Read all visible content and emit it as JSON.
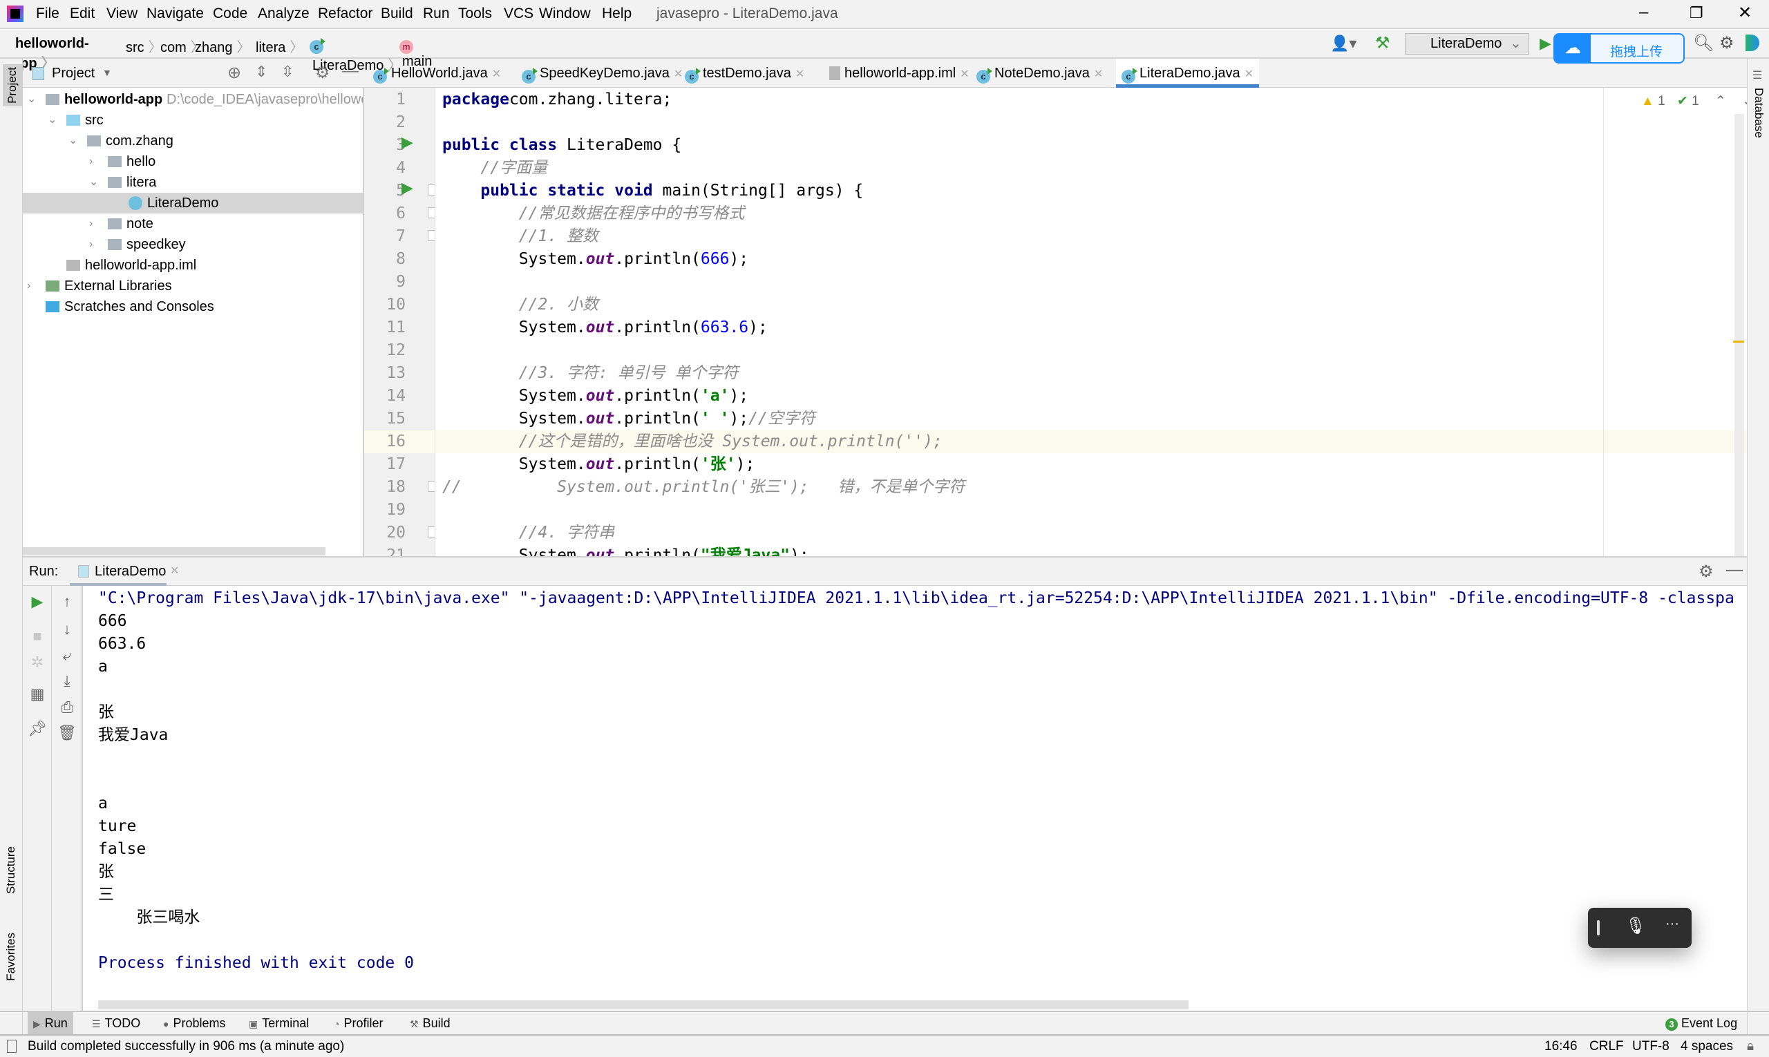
{
  "window": {
    "title": "javasepro - LiteraDemo.java"
  },
  "menu": [
    "File",
    "Edit",
    "View",
    "Navigate",
    "Code",
    "Analyze",
    "Refactor",
    "Build",
    "Run",
    "Tools",
    "VCS",
    "Window",
    "Help"
  ],
  "breadcrumb": [
    "helloworld-app",
    "src",
    "com",
    "zhang",
    "litera",
    "LiteraDemo",
    "main"
  ],
  "toolbar": {
    "run_config": "LiteraDemo",
    "upload_label": "拖拽上传"
  },
  "project": {
    "header": "Project",
    "tree": [
      {
        "label": "helloworld-app",
        "extra": "D:\\code_IDEA\\javasepro\\hellowor",
        "depth": 0,
        "state": "open",
        "kind": "module"
      },
      {
        "label": "src",
        "depth": 1,
        "state": "open",
        "kind": "src"
      },
      {
        "label": "com.zhang",
        "depth": 2,
        "state": "open",
        "kind": "package"
      },
      {
        "label": "hello",
        "depth": 3,
        "state": "closed",
        "kind": "package"
      },
      {
        "label": "litera",
        "depth": 3,
        "state": "open",
        "kind": "package"
      },
      {
        "label": "LiteraDemo",
        "depth": 4,
        "state": "none",
        "kind": "class",
        "selected": true
      },
      {
        "label": "note",
        "depth": 3,
        "state": "closed",
        "kind": "package"
      },
      {
        "label": "speedkey",
        "depth": 3,
        "state": "closed",
        "kind": "package"
      },
      {
        "label": "helloworld-app.iml",
        "depth": 1,
        "state": "none",
        "kind": "file"
      },
      {
        "label": "External Libraries",
        "depth": 0,
        "state": "closed",
        "kind": "lib"
      },
      {
        "label": "Scratches and Consoles",
        "depth": 0,
        "state": "none",
        "kind": "scratch"
      }
    ]
  },
  "tabs": [
    {
      "label": "HelloWorld.java"
    },
    {
      "label": "SpeedKeyDemo.java"
    },
    {
      "label": "testDemo.java"
    },
    {
      "label": "helloworld-app.iml"
    },
    {
      "label": "NoteDemo.java"
    },
    {
      "label": "LiteraDemo.java",
      "active": true
    }
  ],
  "inspections": {
    "warnings": "1",
    "weak_warnings": "1"
  },
  "editor": {
    "current_line": 16,
    "lines": [
      [
        [
          "kw",
          "package"
        ],
        [
          "",
          "com.zhang.litera;"
        ]
      ],
      [],
      [
        [
          "kw",
          "public class"
        ],
        [
          "",
          " LiteraDemo {"
        ]
      ],
      [
        [
          "",
          "    "
        ],
        [
          "cm",
          "//字面量"
        ]
      ],
      [
        [
          "",
          "    "
        ],
        [
          "kw",
          "public static void"
        ],
        [
          "",
          " main(String[] args) {"
        ]
      ],
      [
        [
          "",
          "        "
        ],
        [
          "cm",
          "//常见数据在程序中的书写格式"
        ]
      ],
      [
        [
          "",
          "        "
        ],
        [
          "cm",
          "//1. 整数"
        ]
      ],
      [
        [
          "",
          "        System."
        ],
        [
          "fld",
          "out"
        ],
        [
          "",
          ".println("
        ],
        [
          "num",
          "666"
        ],
        [
          "",
          ");"
        ]
      ],
      [],
      [
        [
          "",
          "        "
        ],
        [
          "cm",
          "//2. 小数"
        ]
      ],
      [
        [
          "",
          "        System."
        ],
        [
          "fld",
          "out"
        ],
        [
          "",
          ".println("
        ],
        [
          "num",
          "663.6"
        ],
        [
          "",
          ");"
        ]
      ],
      [],
      [
        [
          "",
          "        "
        ],
        [
          "cm",
          "//3. 字符: 单引号 单个字符"
        ]
      ],
      [
        [
          "",
          "        System."
        ],
        [
          "fld",
          "out"
        ],
        [
          "",
          ".println("
        ],
        [
          "str",
          "'a'"
        ],
        [
          "",
          ");"
        ]
      ],
      [
        [
          "",
          "        System."
        ],
        [
          "fld",
          "out"
        ],
        [
          "",
          ".println("
        ],
        [
          "str",
          "' '"
        ],
        [
          "",
          ");"
        ],
        [
          "cm",
          "//空字符"
        ]
      ],
      [
        [
          "",
          "        "
        ],
        [
          "cm",
          "//这个是错的，里面啥也没 System.out.println('');"
        ]
      ],
      [
        [
          "",
          "        System."
        ],
        [
          "fld",
          "out"
        ],
        [
          "",
          ".println("
        ],
        [
          "str",
          "'张'"
        ],
        [
          "",
          ");"
        ]
      ],
      [
        [
          "cm",
          "//          System.out.println('张三');   错，不是单个字符"
        ]
      ],
      [],
      [
        [
          "",
          "        "
        ],
        [
          "cm",
          "//4. 字符串"
        ]
      ],
      [
        [
          "",
          "        System."
        ],
        [
          "fld",
          "out"
        ],
        [
          "",
          ".println("
        ],
        [
          "str",
          "\"我爱Java\""
        ],
        [
          "",
          ");"
        ]
      ]
    ]
  },
  "run": {
    "label": "Run:",
    "tab": "LiteraDemo",
    "output": [
      {
        "text": "\"C:\\Program Files\\Java\\jdk-17\\bin\\java.exe\" \"-javaagent:D:\\APP\\IntelliJIDEA 2021.1.1\\lib\\idea_rt.jar=52254:D:\\APP\\IntelliJIDEA 2021.1.1\\bin\" -Dfile.encoding=UTF-8 -classpa",
        "kind": "cmd"
      },
      {
        "text": "666"
      },
      {
        "text": "663.6"
      },
      {
        "text": "a"
      },
      {
        "text": " "
      },
      {
        "text": "张"
      },
      {
        "text": "我爱Java"
      },
      {
        "text": ""
      },
      {
        "text": ""
      },
      {
        "text": "a"
      },
      {
        "text": "ture"
      },
      {
        "text": "false"
      },
      {
        "text": "张"
      },
      {
        "text": "三"
      },
      {
        "text": "\t张三喝水"
      },
      {
        "text": ""
      },
      {
        "text": "Process finished with exit code 0",
        "kind": "cmd"
      }
    ]
  },
  "side": {
    "left_top": "Project",
    "structure": "Structure",
    "favorites": "Favorites",
    "right": "Database"
  },
  "bottom_tabs": [
    "Run",
    "TODO",
    "Problems",
    "Terminal",
    "Profiler",
    "Build"
  ],
  "event_log": {
    "label": "Event Log",
    "count": "3"
  },
  "status": {
    "message": "Build completed successfully in 906 ms (a minute ago)",
    "position": "16:46",
    "line_sep": "CRLF",
    "encoding": "UTF-8",
    "indent": "4 spaces"
  },
  "colors": {
    "accent": "#4083c9",
    "keyword": "#000080",
    "number": "#0000ff",
    "string": "#008000",
    "comment": "#8c8c8c",
    "run_green": "#3a9f3a"
  }
}
